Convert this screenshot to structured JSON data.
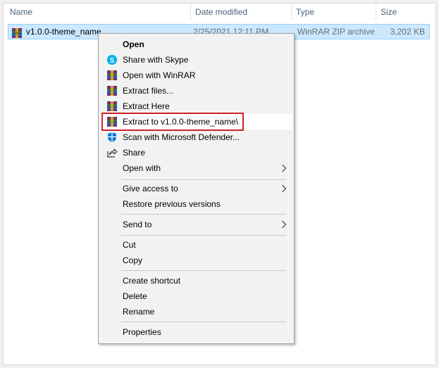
{
  "columns": {
    "name": "Name",
    "date": "Date modified",
    "type": "Type",
    "size": "Size"
  },
  "file": {
    "name": "v1.0.0-theme_name",
    "date": "2/25/2021 12:11 PM",
    "type": "WinRAR ZIP archive",
    "size": "3,202 KB",
    "icon": "winrar-archive-icon"
  },
  "menu": {
    "items": [
      {
        "label": "Open",
        "icon": ""
      },
      {
        "label": "Share with Skype",
        "icon": "skype-icon"
      },
      {
        "label": "Open with WinRAR",
        "icon": "winrar-icon"
      },
      {
        "label": "Extract files...",
        "icon": "winrar-icon"
      },
      {
        "label": "Extract Here",
        "icon": "winrar-icon"
      },
      {
        "label": "Extract to v1.0.0-theme_name\\",
        "icon": "winrar-icon"
      },
      {
        "label": "Scan with Microsoft Defender...",
        "icon": "defender-shield-icon"
      },
      {
        "label": "Share",
        "icon": "share-icon"
      },
      {
        "label": "Open with",
        "icon": ""
      },
      {
        "label": "Give access to",
        "icon": ""
      },
      {
        "label": "Restore previous versions",
        "icon": ""
      },
      {
        "label": "Send to",
        "icon": ""
      },
      {
        "label": "Cut",
        "icon": ""
      },
      {
        "label": "Copy",
        "icon": ""
      },
      {
        "label": "Create shortcut",
        "icon": ""
      },
      {
        "label": "Delete",
        "icon": ""
      },
      {
        "label": "Rename",
        "icon": ""
      },
      {
        "label": "Properties",
        "icon": ""
      }
    ]
  },
  "colors": {
    "selection": "#cce8ff",
    "highlight_border": "#d0202c",
    "skype": "#00aff0",
    "defender": "#0078d7"
  }
}
